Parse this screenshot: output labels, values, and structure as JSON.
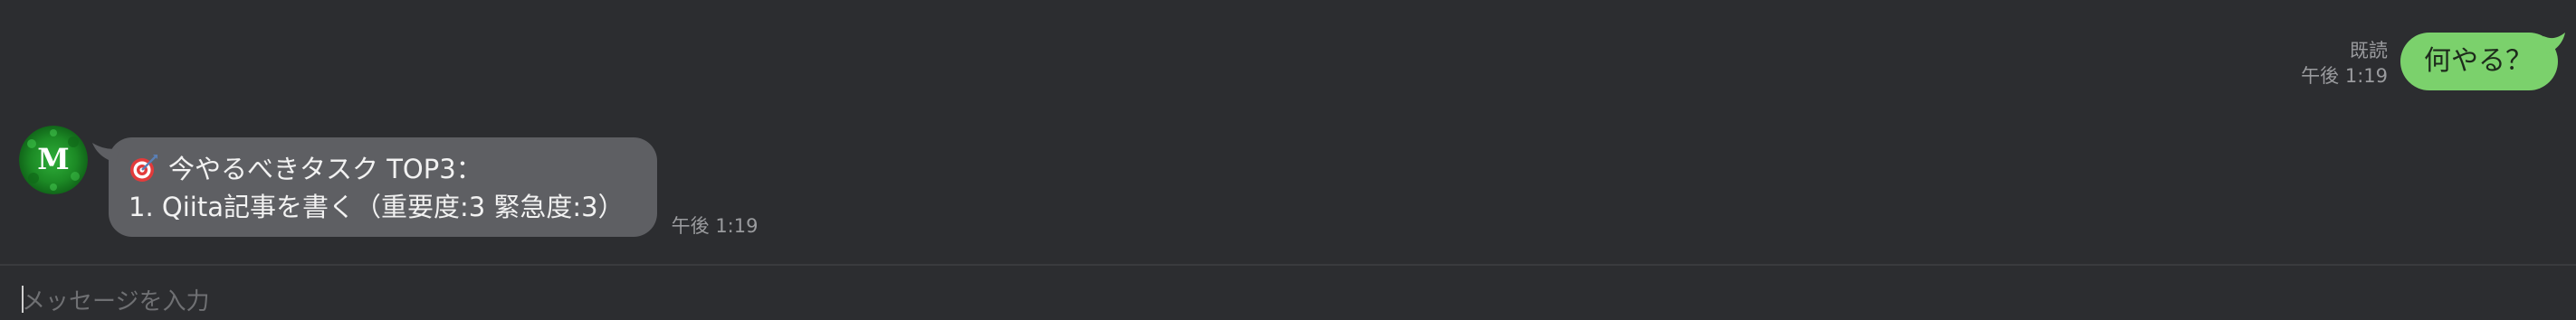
{
  "outgoing": {
    "read_label": "既読",
    "time": "午後 1:19",
    "text": "何やる？",
    "bubble_color": "#7bd16c"
  },
  "incoming": {
    "avatar_letter": "M",
    "avatar_color": "#1f8a2a",
    "line1": "今やるべきタスク TOP3：",
    "line2": "1. Qiita記事を書く（重要度:3 緊急度:3）",
    "icon": "target-icon",
    "time": "午後 1:19",
    "bubble_color": "#5e5f63"
  },
  "input": {
    "placeholder": "メッセージを入力",
    "value": ""
  }
}
